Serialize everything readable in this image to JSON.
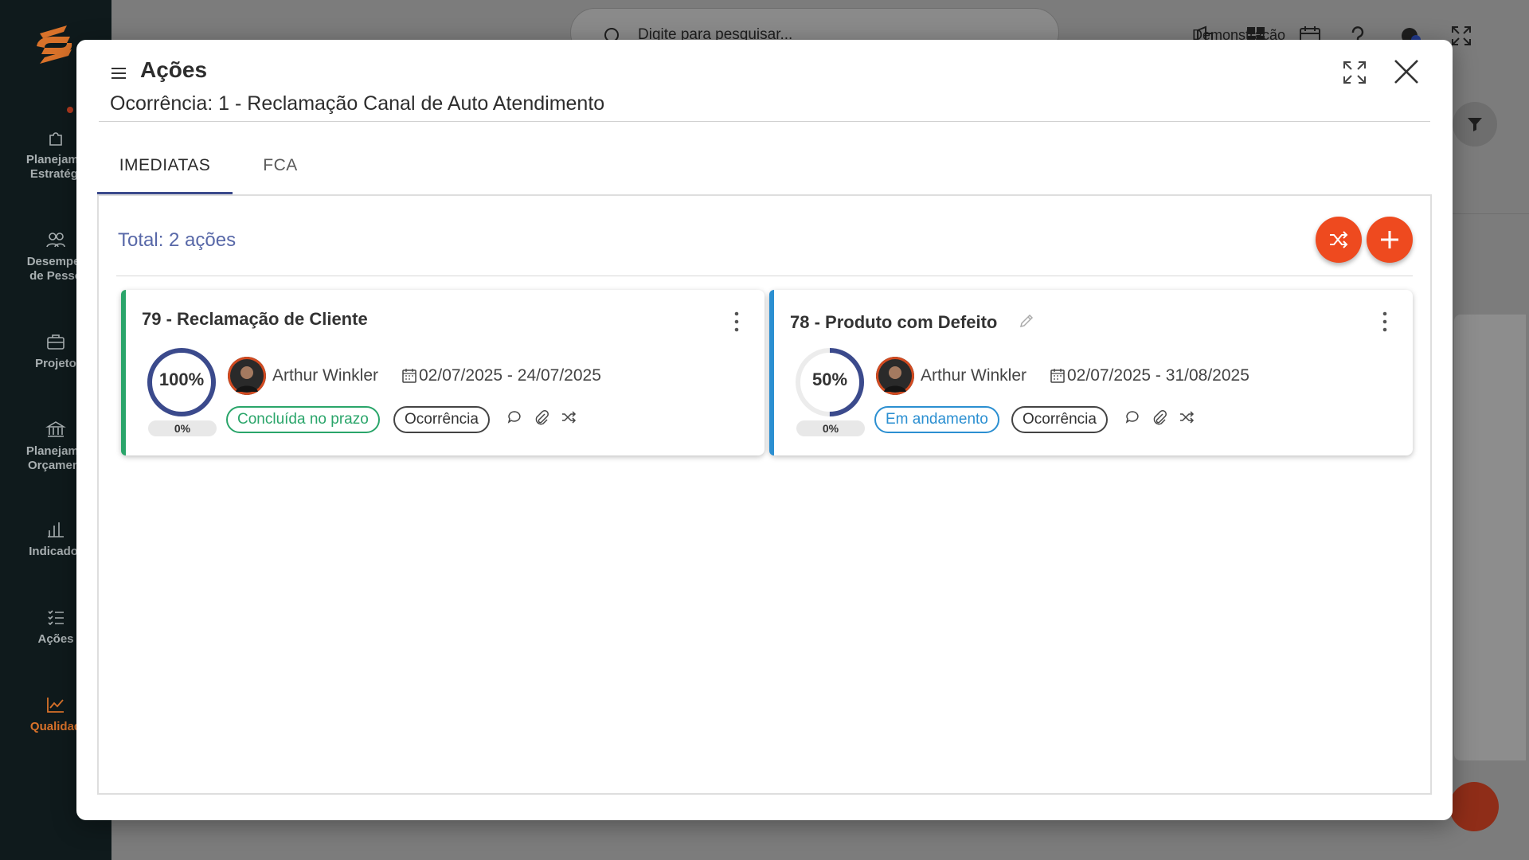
{
  "background": {
    "sidebar_items": [
      {
        "icon": "puzzle-icon",
        "label_line1": "Planejame",
        "label_line2": "Estratégi"
      },
      {
        "icon": "people-icon",
        "label_line1": "Desemper",
        "label_line2": "de Pesso"
      },
      {
        "icon": "briefcase-icon",
        "label_line1": "Projeto",
        "label_line2": ""
      },
      {
        "icon": "bank-icon",
        "label_line1": "Planejame",
        "label_line2": "Orçament"
      },
      {
        "icon": "bar-chart-icon",
        "label_line1": "Indicador",
        "label_line2": ""
      },
      {
        "icon": "checklist-icon",
        "label_line1": "Ações",
        "label_line2": ""
      },
      {
        "icon": "line-chart-icon",
        "label_line1": "Qualidad",
        "label_line2": ""
      }
    ],
    "search_placeholder": "Digite para pesquisar...",
    "company": "Demonstração",
    "accent_color": "#ee4a1f"
  },
  "modal": {
    "title": "Ações",
    "subtitle": "Ocorrência: 1 - Reclamação Canal de Auto Atendimento",
    "tabs": [
      {
        "label": "IMEDIATAS",
        "active": true
      },
      {
        "label": "FCA",
        "active": false
      }
    ],
    "total_label": "Total: 2 ações",
    "cards": [
      {
        "title": "79 - Reclamação de Cliente",
        "progress_label": "100%",
        "progress": 1.0,
        "sub_progress_label": "0%",
        "person": "Arthur Winkler",
        "dates": "02/07/2025 - 24/07/2025",
        "status": "Concluída no prazo",
        "type": "Ocorrência",
        "bar_color": "#2aa56a",
        "editable": false
      },
      {
        "title": "78 - Produto com Defeito",
        "progress_label": "50%",
        "progress": 0.5,
        "sub_progress_label": "0%",
        "person": "Arthur Winkler",
        "dates": "02/07/2025 - 31/08/2025",
        "status": "Em andamento",
        "type": "Ocorrência",
        "bar_color": "#2b8fd1",
        "editable": true
      }
    ]
  }
}
